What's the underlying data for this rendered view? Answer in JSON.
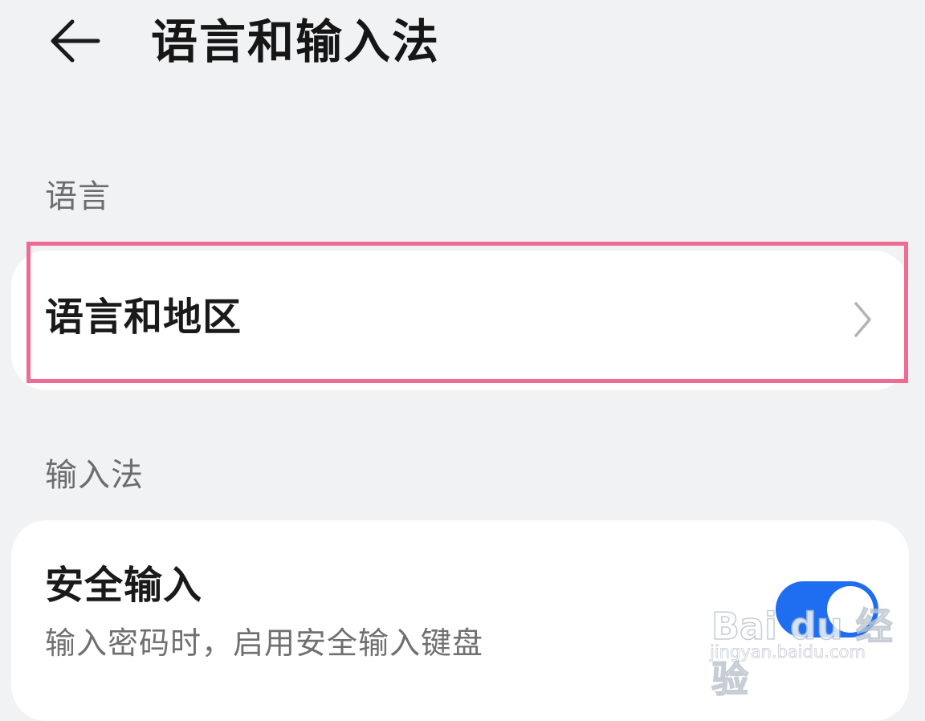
{
  "header": {
    "title": "语言和输入法"
  },
  "sections": {
    "language": {
      "label": "语言",
      "item_title": "语言和地区"
    },
    "input_method": {
      "label": "输入法",
      "item_title": "安全输入",
      "item_subtitle": "输入密码时，启用安全输入键盘",
      "toggle_on": true
    }
  },
  "watermark": {
    "brand": "Bai du 经验",
    "url": "jingyan.baidu.com"
  },
  "colors": {
    "background": "#f1f2f4",
    "card": "#ffffff",
    "highlight": "#ee6b93",
    "toggle_active": "#1f6df0"
  },
  "icons": {
    "back": "arrow-left-icon",
    "row_arrow": "chevron-right-icon"
  }
}
